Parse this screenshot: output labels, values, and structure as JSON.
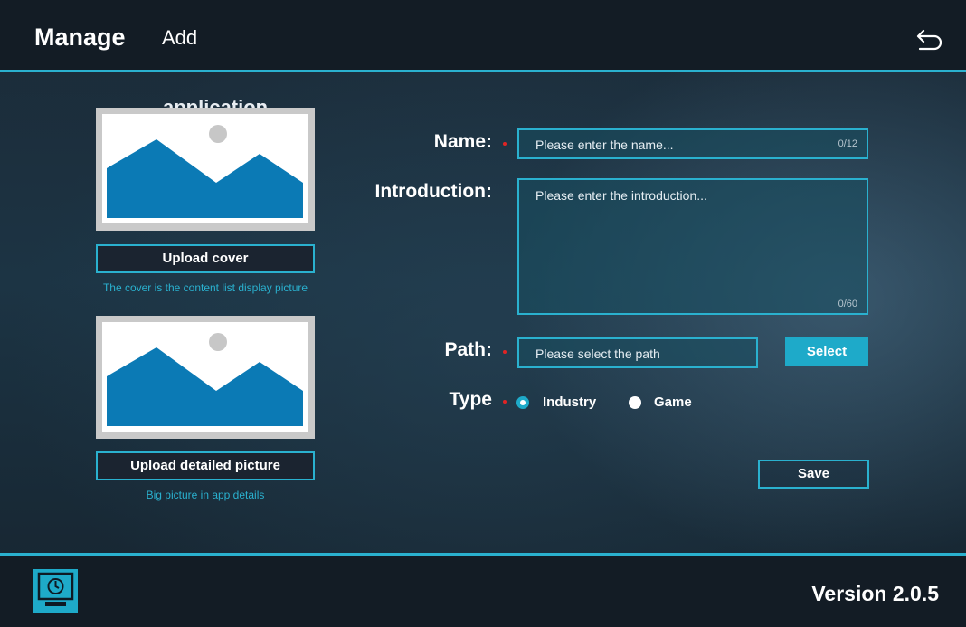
{
  "header": {
    "title": "Manage",
    "subtitle": "Add",
    "back_icon": "undo-arrow-icon"
  },
  "left_panel": {
    "overflow_heading": "application",
    "cover": {
      "image_icon": "image-placeholder-icon",
      "button_label": "Upload cover",
      "hint": "The cover is the content list display picture"
    },
    "detail": {
      "image_icon": "image-placeholder-icon",
      "button_label": "Upload detailed picture",
      "hint": "Big picture in app details"
    }
  },
  "form": {
    "name": {
      "label": "Name:",
      "placeholder": "Please enter the name...",
      "counter": "0/12"
    },
    "introduction": {
      "label": "Introduction:",
      "placeholder": "Please enter the introduction...",
      "counter": "0/60"
    },
    "path": {
      "label": "Path:",
      "placeholder": "Please select the path",
      "select_label": "Select"
    },
    "type": {
      "label": "Type",
      "options": [
        "Industry",
        "Game"
      ],
      "selected": "Industry"
    },
    "save_label": "Save"
  },
  "footer": {
    "icon": "monitor-icon",
    "version": "Version 2.0.5"
  },
  "colors": {
    "accent": "#2ab1cf",
    "required": "#e02424",
    "header_bg": "#131c25"
  }
}
